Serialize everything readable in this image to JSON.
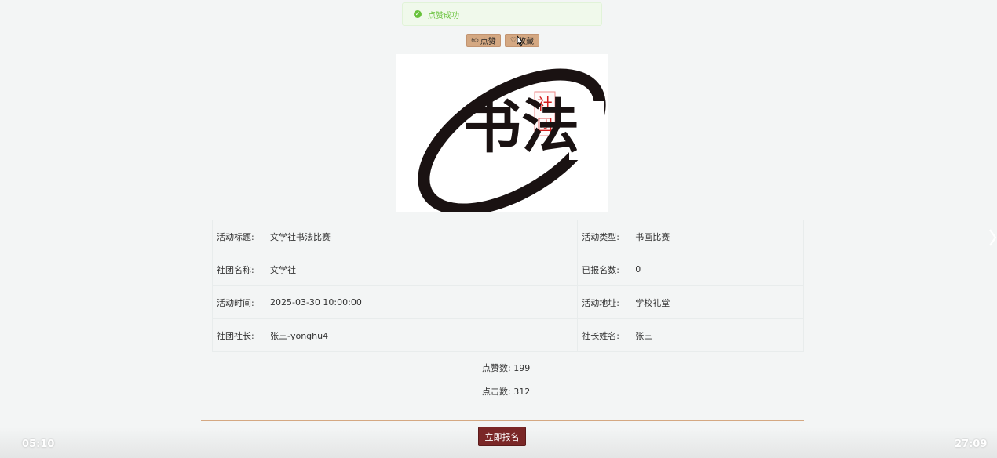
{
  "toast": {
    "message": "点赞成功",
    "icon": "check-circle-icon",
    "color": "#67c23a"
  },
  "actions": {
    "like_label": "点赞",
    "like_icon": "thumbs-up-icon",
    "favorite_label": "收藏",
    "favorite_icon": "heart-icon"
  },
  "logo": {
    "main_text": "书法",
    "seal_chars": [
      "社",
      "团"
    ]
  },
  "details": [
    {
      "left_label": "活动标题:",
      "left_value": "文学社书法比赛",
      "right_label": "活动类型:",
      "right_value": "书画比赛"
    },
    {
      "left_label": "社团名称:",
      "left_value": "文学社",
      "right_label": "已报名数:",
      "right_value": "0"
    },
    {
      "left_label": "活动时间:",
      "left_value": "2025-03-30 10:00:00",
      "right_label": "活动地址:",
      "right_value": "学校礼堂"
    },
    {
      "left_label": "社团社长:",
      "left_value": "张三-yonghu4",
      "right_label": "社长姓名:",
      "right_value": "张三"
    }
  ],
  "stats": {
    "likes_label": "点赞数:",
    "likes_value": "199",
    "clicks_label": "点击数:",
    "clicks_value": "312"
  },
  "signup_label": "立即报名",
  "video": {
    "elapsed": "05:10",
    "duration": "27:09"
  },
  "colors": {
    "accent": "#d4a882",
    "signup": "#7a2727",
    "background": "#f3f5f5"
  }
}
